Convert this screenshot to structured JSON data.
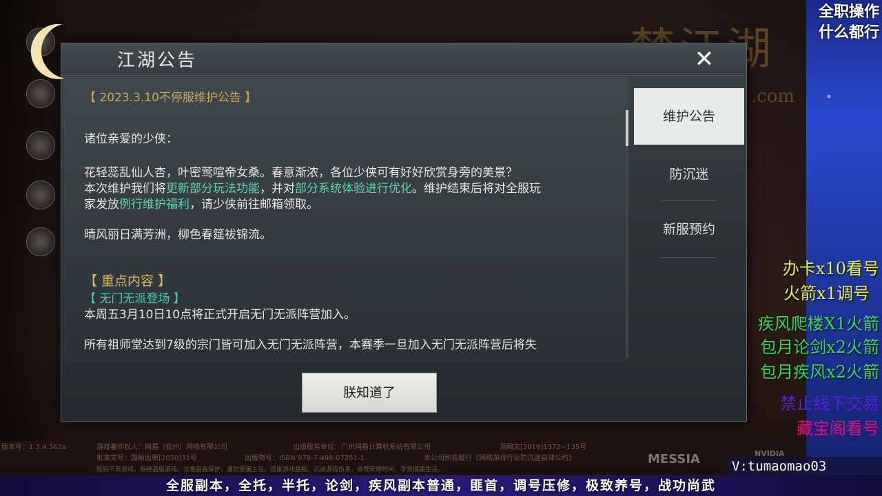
{
  "dialog": {
    "title": "江湖公告",
    "close_symbol": "✕",
    "ok_button": "朕知道了"
  },
  "announcement": {
    "heading": "【 2023.3.10不停服维护公告 】",
    "greeting": "诸位亲爱的少侠：",
    "line1": "花轻蕊乱仙人杏，叶密莺喧帝女桑。春意渐浓，各位少侠可有好好欣赏身旁的美景？",
    "line2_a": "本次维护我们将",
    "line2_b": "更新部分玩法功能",
    "line2_c": "，并对",
    "line2_d": "部分系统体验进行优化",
    "line2_e": "。维护结束后将对全服玩",
    "line3_a": "家发放",
    "line3_b": "例行维护福利",
    "line3_c": "，请少侠前往邮箱领取。",
    "line4": "晴风丽日满芳洲，柳色春筵祓锦流。",
    "section_key": "【 重点内容 】",
    "section_sub": "【 无门无派登场 】",
    "line5": "本周五3月10日10点将正式开启无门无派阵营加入。",
    "line6": "所有祖师堂达到7级的宗门皆可加入无门无派阵营，本赛季一旦加入无门无派阵营后将失"
  },
  "tabs": [
    {
      "label": "维护公告",
      "active": true
    },
    {
      "label": "防沉迷",
      "active": false
    },
    {
      "label": "新服预约",
      "active": false
    }
  ],
  "background": {
    "logo": "梦江湖",
    "logo_com": ".com",
    "messiah": "MESSIA",
    "nvidia": "NVIDIA"
  },
  "copyright": {
    "version": "版本号：1.3.4.362a",
    "owner": "游戏著作权人：网易（杭州）网络有限公司",
    "publisher": "出版服务单位：广州网易计算机系统有限公司",
    "license": "浙网文[2019]1372−135号",
    "approval": "批准文号：国新出审[2020]31号",
    "isbn": "出版物号：ISBN 978-7-498-07251-1",
    "pledge": "本公司积极履行《网络游戏行业防沉迷自律公约》",
    "advice": "抵制不良游戏，拒绝盗版游戏。注意自我保护，谨防受骗上当。适度游戏益脑，沉迷游戏伤身。合理安排时间，享受健康生活。"
  },
  "stream_overlay": {
    "top_line1": "全职操作",
    "top_line2": "什么都行",
    "ad1": "办卡x10看号",
    "ad2": "火箭x1调号",
    "ad3": "疾风爬楼X1火箭",
    "ad4": "包月论剑x2火箭",
    "ad5": "包月疾风x2火箭",
    "ad6": "禁止线下交易",
    "ad7": "藏宝阁看号",
    "handle": "V:tumaomao03",
    "banner": "全服副本，全托，半托，论剑，疾风副本普通，匪首，调号压修，极致养号，战功尚武"
  }
}
